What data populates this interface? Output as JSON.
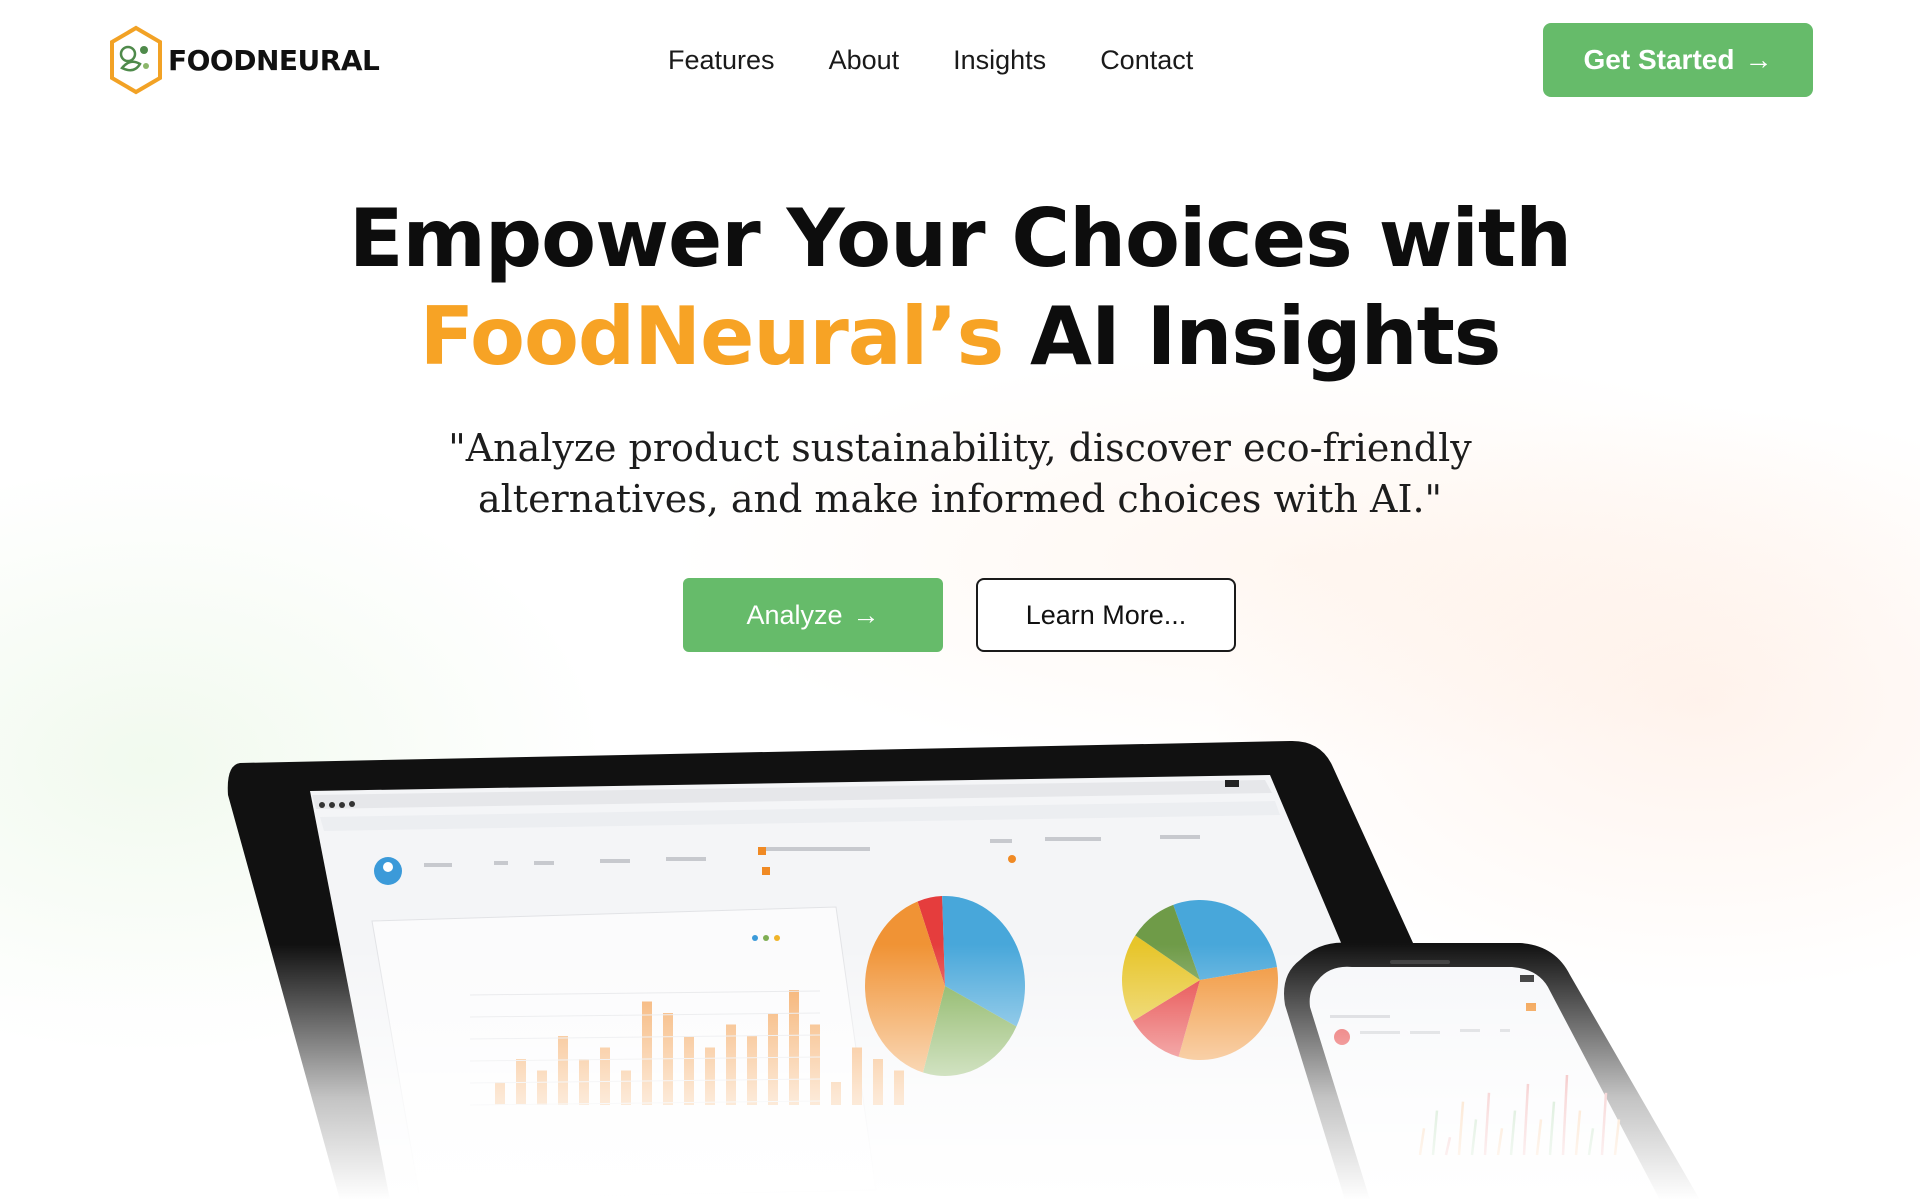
{
  "nav": {
    "logo_text": "FOODNEURAL",
    "links": [
      "Features",
      "About",
      "Insights",
      "Contact"
    ],
    "cta_label": "Get Started",
    "cta_arrow": "→"
  },
  "hero": {
    "title_line1": "Empower Your Choices with",
    "title_accent": "FoodNeural’s",
    "title_rest": " AI Insights",
    "subtitle": "\"Analyze product sustainability, discover eco-friendly alternatives, and make informed choices with AI.\"",
    "analyze_label": "Analyze",
    "analyze_arrow": "→",
    "learn_label": "Learn More..."
  },
  "colors": {
    "brand_green": "#66bb6a",
    "accent_orange": "#f7a325",
    "text_dark": "#0d0d0d"
  },
  "tablet_mock": {
    "bar_chart": {
      "type": "bar",
      "values": [
        2,
        4,
        3,
        6,
        4,
        5,
        3,
        9,
        8,
        6,
        5,
        7,
        6,
        8,
        10,
        7,
        2,
        5,
        4,
        3
      ]
    },
    "pie_left": {
      "type": "pie",
      "slices": [
        {
          "value": 5,
          "color": "#e53d3d"
        },
        {
          "value": 33,
          "color": "#48a7da"
        },
        {
          "value": 22,
          "color": "#7fae53"
        },
        {
          "value": 40,
          "color": "#f09335"
        }
      ]
    },
    "pie_right": {
      "type": "pie",
      "slices": [
        {
          "value": 28,
          "color": "#48a7da"
        },
        {
          "value": 32,
          "color": "#f09335"
        },
        {
          "value": 12,
          "color": "#e53d3d"
        },
        {
          "value": 18,
          "color": "#e7c52a"
        },
        {
          "value": 10,
          "color": "#6f9b48"
        }
      ]
    }
  },
  "phone_mock": {
    "bar_chart": {
      "type": "bar",
      "values": [
        3,
        5,
        2,
        6,
        4,
        7,
        3,
        5,
        8,
        4,
        6,
        9,
        5,
        3,
        7,
        4
      ]
    }
  }
}
